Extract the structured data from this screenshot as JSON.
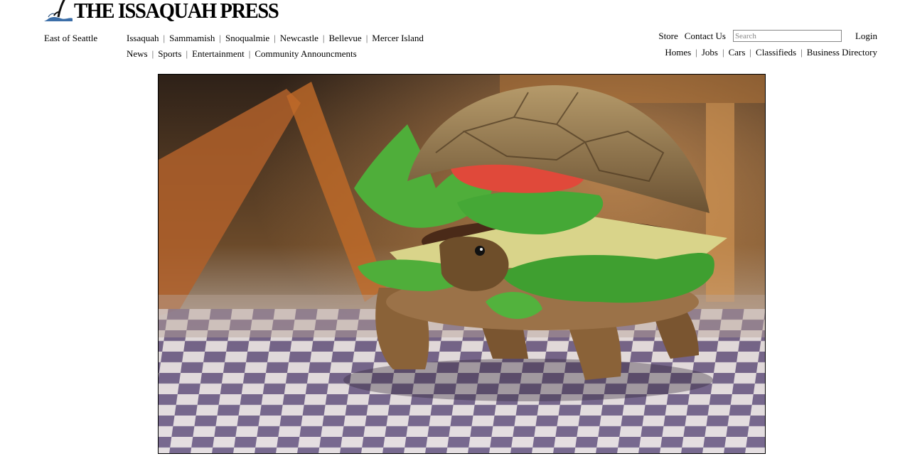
{
  "masthead": {
    "title": "THE ISSAQUAH PRESS",
    "logo_icon": "heron-logo-icon"
  },
  "tagline": "East of Seattle",
  "nav_primary": [
    {
      "label": "Issaquah"
    },
    {
      "label": "Sammamish"
    },
    {
      "label": "Snoqualmie"
    },
    {
      "label": "Newcastle"
    },
    {
      "label": "Bellevue"
    },
    {
      "label": "Mercer Island"
    }
  ],
  "nav_secondary": [
    {
      "label": "News"
    },
    {
      "label": "Sports"
    },
    {
      "label": "Entertainment"
    },
    {
      "label": "Community Announcments"
    }
  ],
  "utility": {
    "store": "Store",
    "contact": "Contact Us",
    "search_placeholder": "Search",
    "login": "Login"
  },
  "classifieds_nav": [
    {
      "label": "Homes"
    },
    {
      "label": "Jobs"
    },
    {
      "label": "Cars"
    },
    {
      "label": "Classifieds"
    },
    {
      "label": "Business Directory"
    }
  ],
  "colors": {
    "background": "#ffffff",
    "text": "#000000"
  }
}
